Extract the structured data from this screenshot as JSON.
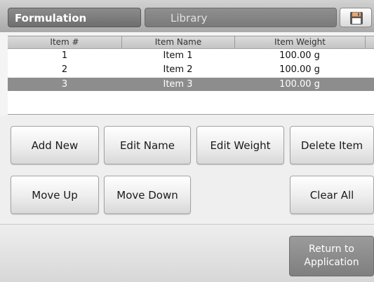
{
  "header": {
    "title_tab": "Formulation",
    "library_tab": "Library",
    "save_icon": "floppy-disk-icon"
  },
  "table": {
    "columns": [
      "Item #",
      "Item Name",
      "Item Weight"
    ],
    "rows": [
      {
        "num": "1",
        "name": "Item 1",
        "weight": "100.00 g",
        "selected": false
      },
      {
        "num": "2",
        "name": "Item 2",
        "weight": "100.00 g",
        "selected": false
      },
      {
        "num": "3",
        "name": "Item 3",
        "weight": "100.00 g",
        "selected": true
      }
    ]
  },
  "buttons": {
    "add_new": "Add New",
    "edit_name": "Edit Name",
    "edit_weight": "Edit Weight",
    "delete_item": "Delete Item",
    "move_up": "Move Up",
    "move_down": "Move Down",
    "clear_all": "Clear All"
  },
  "footer": {
    "return_line1": "Return to",
    "return_line2": "Application"
  },
  "colors": {
    "selected_row": "#8d8d8d",
    "header_bar": "#a9a9a9"
  }
}
